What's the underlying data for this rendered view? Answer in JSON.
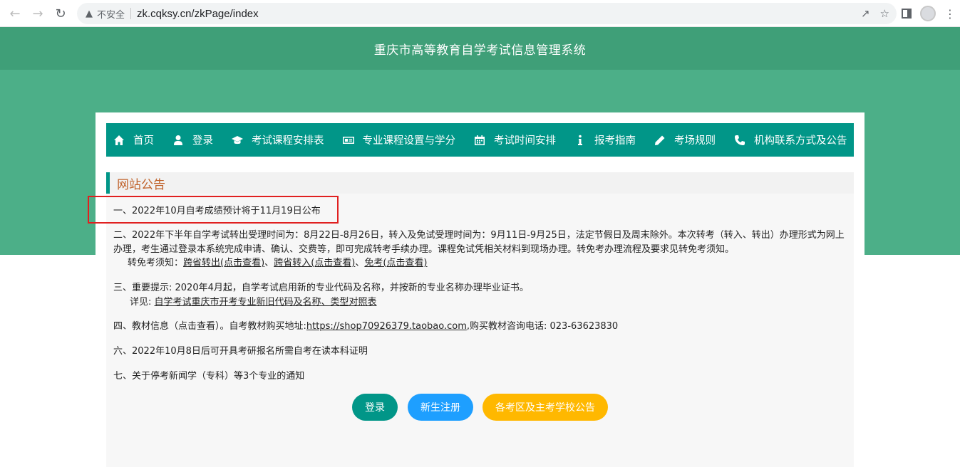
{
  "browser": {
    "back_icon": "arrow-left-icon",
    "forward_icon": "arrow-right-icon",
    "reload_icon": "reload-icon",
    "insecure_label": "不安全",
    "url": "zk.cqksy.cn/zkPage/index"
  },
  "header": {
    "title": "重庆市高等教育自学考试信息管理系统"
  },
  "menu": {
    "items": [
      {
        "label": "首页",
        "icon": "home-icon"
      },
      {
        "label": "登录",
        "icon": "user-icon"
      },
      {
        "label": "考试课程安排表",
        "icon": "graduation-cap-icon"
      },
      {
        "label": "专业课程设置与学分",
        "icon": "id-card-icon"
      },
      {
        "label": "考试时间安排",
        "icon": "calendar-icon"
      },
      {
        "label": "报考指南",
        "icon": "info-icon"
      },
      {
        "label": "考场规则",
        "icon": "pencil-icon"
      },
      {
        "label": "机构联系方式及公告",
        "icon": "phone-icon"
      }
    ]
  },
  "notices": {
    "section_title": "网站公告",
    "n1": "一、2022年10月自考成绩预计将于11月19日公布",
    "n2": "二、2022年下半年自学考试转出受理时间为：8月22日-8月26日，转入及免试受理时间为：9月11日-9月25日，法定节假日及周末除外。本次转考（转入、转出）办理形式为网上办理，考生通过登录本系统完成申请、确认、交费等，即可完成转考手续办理。课程免试凭相关材料到现场办理。转免考办理流程及要求见转免考须知。",
    "n2_sub_label": "转免考须知：",
    "n2_link1": "跨省转出(点击查看)",
    "n2_sep1": "、",
    "n2_link2": "跨省转入(点击查看)",
    "n2_sep2": "、",
    "n2_link3": "免考(点击查看)",
    "n3": "三、重要提示: 2020年4月起，自学考试启用新的专业代码及名称，并按新的专业名称办理毕业证书。",
    "n3_sub_label": "详见: ",
    "n3_link": "自学考试重庆市开考专业新旧代码及名称、类型对照表",
    "n4_prefix": "四、教材信息（点击查看）。自考教材购买地址:",
    "n4_link": "https://shop70926379.taobao.com",
    "n4_suffix": ",购买教材咨询电话:  023-63623830",
    "n6": "六、2022年10月8日后可开具考研报名所需自考在读本科证明",
    "n7": "七、关于停考新闻学（专科）等3个专业的通知"
  },
  "buttons": {
    "login": "登录",
    "register": "新生注册",
    "exam_notice": "各考区及主考学校公告"
  },
  "colors": {
    "header_band": "#3f9f78",
    "green_band": "#4caf88",
    "menu_bg": "#019688",
    "section_title": "#c0622a",
    "btn_register": "#1e9fff",
    "btn_notice": "#ffb800",
    "highlight_border": "#e02020"
  }
}
